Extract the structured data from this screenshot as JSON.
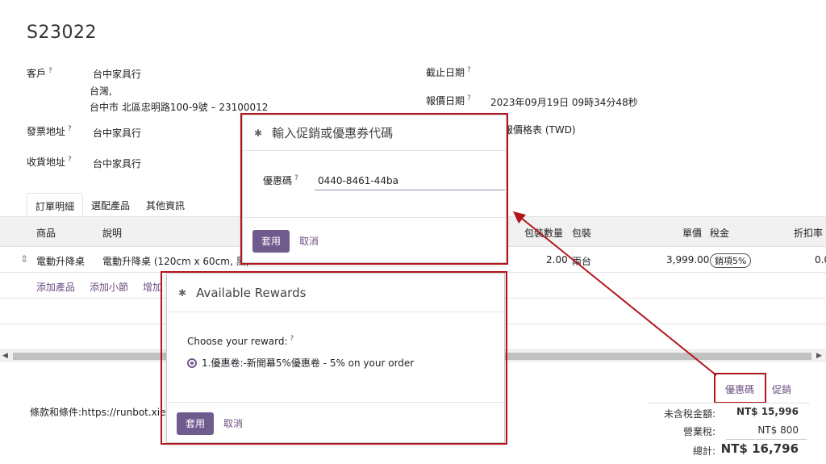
{
  "record": {
    "title": "S23022"
  },
  "form": {
    "customer_label": "客戶",
    "customer_name": "台中家具行",
    "customer_addr1": "台灣,",
    "customer_addr2": "台中市 北區忠明路100-9號 – 23100012",
    "invoice_label": "發票地址",
    "invoice_value": "台中家具行",
    "delivery_label": "收貨地址",
    "delivery_value": "台中家具行",
    "expiry_label": "截止日期",
    "quote_date_label": "報價日期",
    "quote_date_value": "2023年09月19日 09時34分48秒",
    "pricelist_value": "報價格表 (TWD)",
    "help": "?"
  },
  "tabs": [
    "訂單明細",
    "選配產品",
    "其他資訊"
  ],
  "table": {
    "headers": {
      "product": "商品",
      "description": "說明",
      "pkg_qty": "包裝數量",
      "packaging": "包裝",
      "unit_price": "單價",
      "taxes": "稅金",
      "discount": "折扣率"
    },
    "row": {
      "product": "電動升降桌",
      "description": "電動升降桌 (120cm x 60cm, 黑)",
      "pkg_qty": "2.00",
      "packaging": "兩台",
      "unit_price": "3,999.00",
      "tax": "銷項5%",
      "discount": "0.0"
    },
    "add_product": "添加產品",
    "add_section": "添加小節",
    "add_note": "增加"
  },
  "bottom": {
    "coupon_link": "優惠碼",
    "promo_link": "促銷",
    "terms": "條款和條件:https://runbot.xie",
    "untaxed_label": "未含稅金額:",
    "untaxed_value": "NT$ 15,996",
    "tax_label": "營業稅:",
    "tax_value": "NT$ 800",
    "total_label": "總計:",
    "total_value": "NT$ 16,796"
  },
  "coupon_dialog": {
    "title": "輸入促銷或優惠券代碼",
    "field_label": "優惠碼",
    "field_value": "0440-8461-44ba",
    "apply": "套用",
    "cancel": "取消"
  },
  "rewards_dialog": {
    "title": "Available Rewards",
    "choose_label": "Choose your reward:",
    "option": "1.優惠卷:-新開幕5%優惠卷 - 5% on your order",
    "apply": "套用",
    "cancel": "取消"
  },
  "colors": {
    "primary": "#6f5b8e",
    "annotation_red": "#b3151c",
    "link": "#6b4e82"
  }
}
